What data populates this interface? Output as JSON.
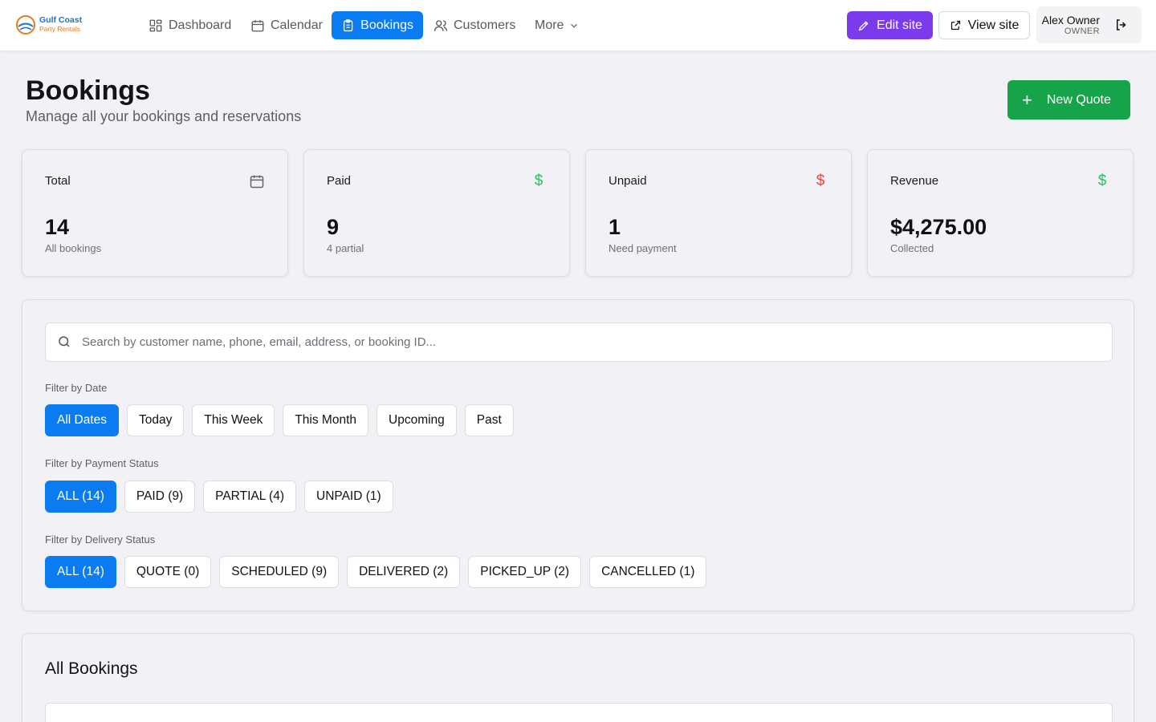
{
  "brand": {
    "line1": "Gulf Coast",
    "line2": "Party Rentals"
  },
  "nav": [
    {
      "label": "Dashboard",
      "icon": "dashboard-icon",
      "active": false
    },
    {
      "label": "Calendar",
      "icon": "calendar-icon",
      "active": false
    },
    {
      "label": "Bookings",
      "icon": "clipboard-icon",
      "active": true
    },
    {
      "label": "Customers",
      "icon": "users-icon",
      "active": false
    },
    {
      "label": "More",
      "icon": "chevron-down-icon",
      "active": false
    }
  ],
  "actions": {
    "edit_site": "Edit site",
    "view_site": "View site"
  },
  "user": {
    "name": "Alex Owner",
    "role": "OWNER"
  },
  "page": {
    "title": "Bookings",
    "subtitle": "Manage all your bookings and reservations",
    "new_quote": "New Quote"
  },
  "stats": [
    {
      "label": "Total",
      "value": "14",
      "note": "All bookings",
      "icon": "calendar-icon"
    },
    {
      "label": "Paid",
      "value": "9",
      "note": "4 partial",
      "icon": "dollar-icon",
      "icon_color": "#22c55e"
    },
    {
      "label": "Unpaid",
      "value": "1",
      "note": "Need payment",
      "icon": "dollar-icon",
      "icon_color": "#ef4444"
    },
    {
      "label": "Revenue",
      "value": "$4,275.00",
      "note": "Collected",
      "icon": "dollar-icon",
      "icon_color": "#22c55e"
    }
  ],
  "search": {
    "placeholder": "Search by customer name, phone, email, address, or booking ID...",
    "value": ""
  },
  "filters": {
    "date": {
      "label": "Filter by Date",
      "options": [
        "All Dates",
        "Today",
        "This Week",
        "This Month",
        "Upcoming",
        "Past"
      ],
      "selected": "All Dates"
    },
    "payment": {
      "label": "Filter by Payment Status",
      "options": [
        "ALL (14)",
        "PAID (9)",
        "PARTIAL (4)",
        "UNPAID (1)"
      ],
      "selected": "ALL (14)"
    },
    "delivery": {
      "label": "Filter by Delivery Status",
      "options": [
        "ALL (14)",
        "QUOTE (0)",
        "SCHEDULED (9)",
        "DELIVERED (2)",
        "PICKED_UP (2)",
        "CANCELLED (1)"
      ],
      "selected": "ALL (14)"
    }
  },
  "bookings": {
    "title": "All Bookings"
  },
  "colors": {
    "primary": "#0b7bf2",
    "edit": "#7c3aed",
    "new_quote": "#16a34a"
  }
}
